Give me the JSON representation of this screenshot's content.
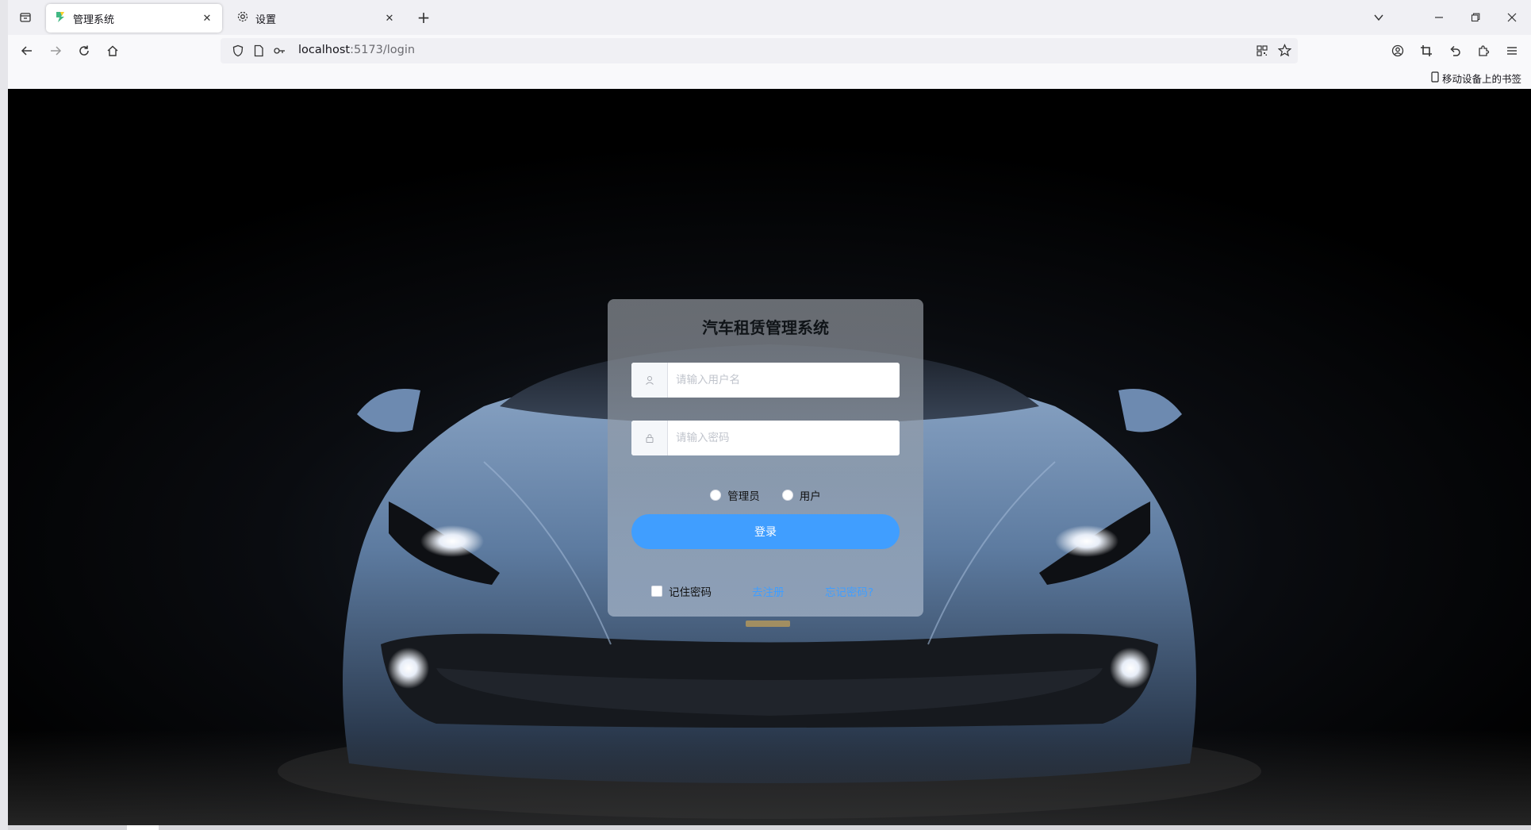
{
  "browser": {
    "tabs": [
      {
        "title": "管理系统",
        "close": "✕"
      },
      {
        "title": "设置",
        "close": "✕"
      }
    ],
    "new_tab": "+",
    "url": {
      "host": "localhost",
      "path": ":5173/login"
    },
    "bookmark": "移动设备上的书签"
  },
  "login": {
    "title": "汽车租赁管理系统",
    "username_placeholder": "请输入用户名",
    "password_placeholder": "请输入密码",
    "roles": [
      {
        "label": "管理员",
        "selected": false
      },
      {
        "label": "用户",
        "selected": false
      }
    ],
    "submit_label": "登录",
    "remember_label": "记住密码",
    "register_link": "去注册",
    "forgot_link": "忘记密码?"
  },
  "colors": {
    "primary": "#409eff",
    "background": "#000000"
  },
  "icons": [
    "tab-list-icon",
    "vite-favicon-icon",
    "gear-icon",
    "chevron-down-icon",
    "minimize-icon",
    "restore-icon",
    "close-icon",
    "back-icon",
    "forward-icon",
    "reload-icon",
    "home-icon",
    "shield-icon",
    "page-icon",
    "key-icon",
    "qr-code-icon",
    "star-icon",
    "account-icon",
    "crop-icon",
    "undo-icon",
    "extensions-icon",
    "menu-icon",
    "mobile-icon",
    "user-icon",
    "lock-icon"
  ]
}
